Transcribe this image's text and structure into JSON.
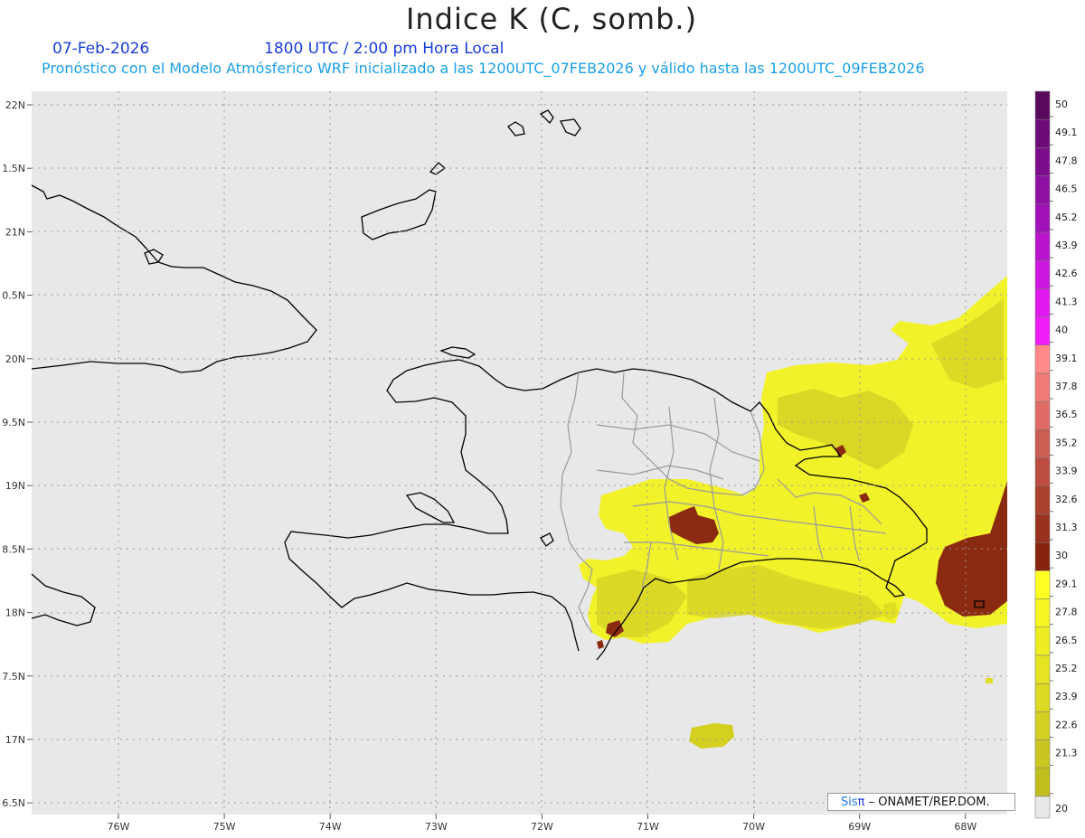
{
  "title": "Indice K (C, somb.)",
  "date": "07-Feb-2026",
  "time": "1800 UTC / 2:00 pm Hora Local",
  "forecast_line": "Pronóstico con el Modelo Atmósferico WRF inicializado a las 1200UTC_07FEB2026 y válido hasta las  1200UTC_09FEB2026",
  "credit": {
    "brand": "Sis",
    "pi": "π",
    "rest": " – ONAMET/REP.DOM."
  },
  "lat_labels": [
    "22N",
    "1.5N",
    "21N",
    "0.5N",
    "20N",
    "9.5N",
    "19N",
    "8.5N",
    "18N",
    "7.5N",
    "17N",
    "6.5N"
  ],
  "lon_labels": [
    "76W",
    "75W",
    "74W",
    "73W",
    "72W",
    "71W",
    "70W",
    "69W",
    "68W"
  ],
  "legend": {
    "levels": [
      "50",
      "49.1",
      "47.8",
      "46.5",
      "45.2",
      "43.9",
      "42.6",
      "41.3",
      "40",
      "39.1",
      "37.8",
      "36.5",
      "35.2",
      "33.9",
      "32.6",
      "31.3",
      "30",
      "29.1",
      "27.8",
      "26.5",
      "25.2",
      "23.9",
      "22.6",
      "21.3",
      "20"
    ],
    "colors": [
      "#5a0a5e",
      "#6e0a78",
      "#7d0d8c",
      "#8e10a2",
      "#a012b8",
      "#b814cc",
      "#cc18de",
      "#e01aee",
      "#f01cfa",
      "#ff8888",
      "#ee7b76",
      "#de6c64",
      "#cd5c52",
      "#bc4d40",
      "#ab3f2e",
      "#98311e",
      "#86240f",
      "#ffff22",
      "#f7f622",
      "#eeed22",
      "#e5e322",
      "#dcda22",
      "#d2d022",
      "#c9c622",
      "#c0bd1e"
    ]
  },
  "map_colors": {
    "background": "#e8e8e8",
    "k_yellow": "#f2f22a",
    "k_olive": "#d4d020",
    "k_brown": "#8a2a10"
  }
}
